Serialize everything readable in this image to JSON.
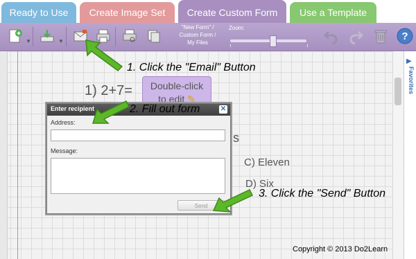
{
  "tabs": [
    {
      "label": "Ready to Use"
    },
    {
      "label": "Create Image Set"
    },
    {
      "label": "Create Custom Form",
      "active": true
    },
    {
      "label": "Use a Template"
    }
  ],
  "toolbar": {
    "file_label_line1": "\"New Form\" /",
    "file_label_line2": "Custom Form /",
    "file_label_line3": "My Files",
    "zoom_label": "Zoom:",
    "zoom_level": 0.56,
    "icons": [
      "new-form-icon",
      "download-icon",
      "email-icon",
      "print-icon",
      "print-preview-icon",
      "copy-icon",
      "undo-icon",
      "redo-icon",
      "trash-icon",
      "help-icon"
    ]
  },
  "sidebar": {
    "favorites_label": "Favorites"
  },
  "canvas": {
    "question": "1) 2+7=",
    "edit_box_line1": "Double-click",
    "edit_box_line2": "to edit",
    "partial_text": "als",
    "choice_c": "C) Eleven",
    "choice_d": "D) Six"
  },
  "dialog": {
    "title": "Enter recipient",
    "close_glyph": "✕",
    "address_label": "Address:",
    "address_value": "",
    "message_label": "Message:",
    "message_value": "",
    "send_label": "Send"
  },
  "annotations": {
    "step1": "1. Click the \"Email\" Button",
    "step2": "2. Fill out form",
    "step3": "3. Click the \"Send\" Button"
  },
  "footer": {
    "copyright": "Copyright © 2013 Do2Learn"
  },
  "colors": {
    "tab_ready": "#7fb9dd",
    "tab_image_set": "#e29a9a",
    "tab_custom_form": "#a88fc0",
    "tab_template": "#88c870",
    "toolbar": "#b09ac8",
    "edit_box": "#cdb6e8",
    "arrow": "#5cb82a"
  }
}
